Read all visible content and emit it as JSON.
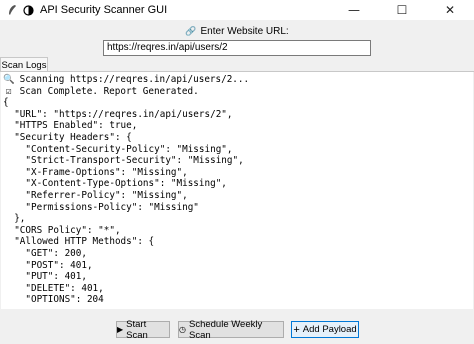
{
  "window": {
    "title": "API Security Scanner GUI",
    "controls": {
      "minimize": "—",
      "maximize": "☐",
      "close": "✕"
    }
  },
  "url_section": {
    "label": "Enter Website URL:",
    "value": "https://reqres.in/api/users/2"
  },
  "tabs": [
    {
      "label": "Scan Logs"
    }
  ],
  "log": {
    "lines": [
      {
        "icon": "magnifier",
        "text": "Scanning https://reqres.in/api/users/2..."
      },
      {
        "icon": "check",
        "text": "Scan Complete. Report Generated."
      },
      {
        "text": "{"
      },
      {
        "text": "  \"URL\": \"https://reqres.in/api/users/2\","
      },
      {
        "text": "  \"HTTPS Enabled\": true,"
      },
      {
        "text": "  \"Security Headers\": {"
      },
      {
        "text": "    \"Content-Security-Policy\": \"Missing\","
      },
      {
        "text": "    \"Strict-Transport-Security\": \"Missing\","
      },
      {
        "text": "    \"X-Frame-Options\": \"Missing\","
      },
      {
        "text": "    \"X-Content-Type-Options\": \"Missing\","
      },
      {
        "text": "    \"Referrer-Policy\": \"Missing\","
      },
      {
        "text": "    \"Permissions-Policy\": \"Missing\""
      },
      {
        "text": "  },"
      },
      {
        "text": "  \"CORS Policy\": \"*\","
      },
      {
        "text": "  \"Allowed HTTP Methods\": {"
      },
      {
        "text": "    \"GET\": 200,"
      },
      {
        "text": "    \"POST\": 401,"
      },
      {
        "text": "    \"PUT\": 401,"
      },
      {
        "text": "    \"DELETE\": 401,"
      },
      {
        "text": "    \"OPTIONS\": 204"
      }
    ]
  },
  "buttons": {
    "start_scan": "Start Scan",
    "schedule": "Schedule Weekly Scan",
    "add_payload": "Add Payload"
  }
}
